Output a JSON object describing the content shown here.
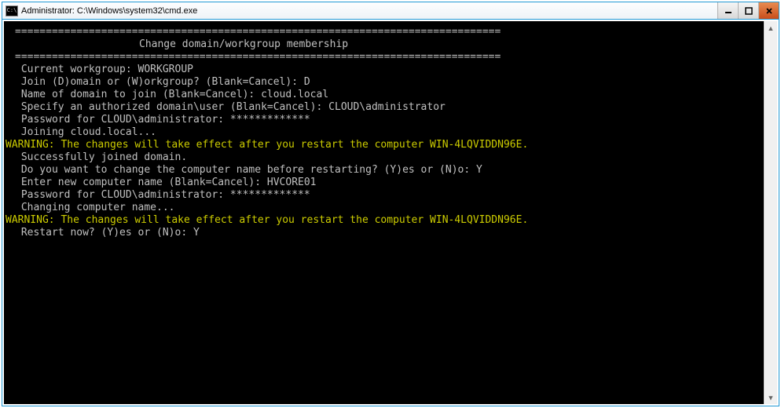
{
  "window": {
    "icon_glyph": "C:\\",
    "title": "Administrator: C:\\Windows\\system32\\cmd.exe"
  },
  "controls": {
    "minimize": "—",
    "maximize": "□",
    "close": "✕"
  },
  "terminal": {
    "rule": "===============================================================================",
    "header": "Change domain/workgroup membership",
    "current_workgroup": " Current workgroup: WORKGROUP",
    "blank": "",
    "join_prompt": " Join (D)omain or (W)orkgroup? (Blank=Cancel): D",
    "domain_name": " Name of domain to join (Blank=Cancel): cloud.local",
    "auth_user": " Specify an authorized domain\\user (Blank=Cancel): CLOUD\\administrator",
    "password1": " Password for CLOUD\\administrator: *************",
    "joining": " Joining cloud.local...",
    "warning1": "WARNING: The changes will take effect after you restart the computer WIN-4LQVIDDN96E.",
    "joined": " Successfully joined domain.",
    "rename_prompt": " Do you want to change the computer name before restarting? (Y)es or (N)o: Y",
    "new_name": " Enter new computer name (Blank=Cancel): HVCORE01",
    "password2": " Password for CLOUD\\administrator: *************",
    "changing": " Changing computer name...",
    "warning2": "WARNING: The changes will take effect after you restart the computer WIN-4LQVIDDN96E.",
    "restart_prompt": " Restart now? (Y)es or (N)o: Y"
  },
  "scrollbar": {
    "up": "▲",
    "down": "▼"
  }
}
